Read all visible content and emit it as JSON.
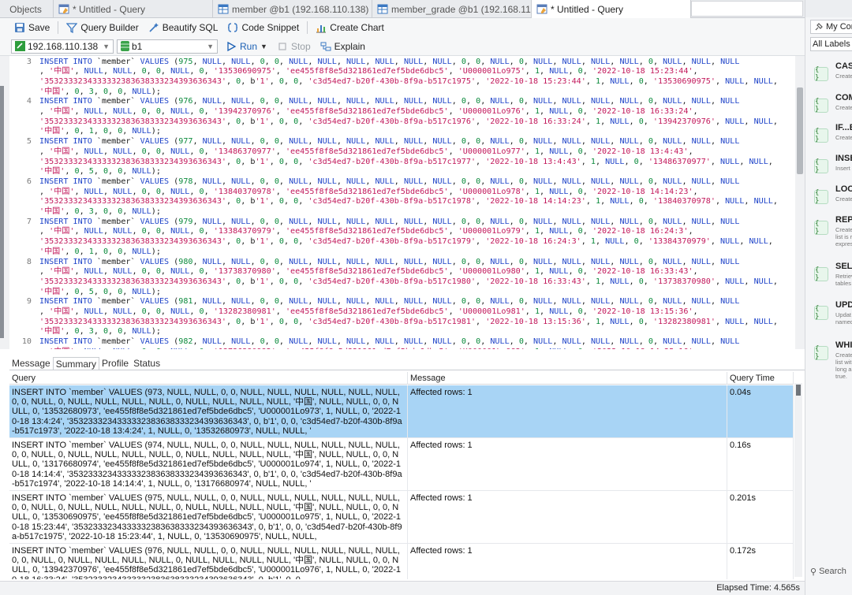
{
  "tabs": [
    {
      "label": "Objects",
      "icon": "none",
      "active": false
    },
    {
      "label": "* Untitled - Query",
      "icon": "query-icon",
      "active": false
    },
    {
      "label": "member @b1 (192.168.110.138) - T...",
      "icon": "table-icon",
      "active": false
    },
    {
      "label": "member_grade @b1 (192.168.110.1...",
      "icon": "table-icon",
      "active": false
    },
    {
      "label": "* Untitled - Query",
      "icon": "query-icon",
      "active": true
    }
  ],
  "toolbar": {
    "save": "Save",
    "query_builder": "Query Builder",
    "beautify_sql": "Beautify SQL",
    "code_snippet": "Code Snippet",
    "create_chart": "Create Chart"
  },
  "connection": {
    "server": "192.168.110.138",
    "database": "b1",
    "run": "Run",
    "stop": "Stop",
    "explain": "Explain"
  },
  "editor": {
    "lines": [
      {
        "n": "3",
        "t": [
          "INSERT INTO `member` VALUES (975, NULL, NULL, 0, 0, NULL, NULL, NULL, NULL, NULL, NULL, 0, 0, NULL, 0, NULL, NULL, NULL, NULL, 0, NULL, NULL, NULL",
          ", '中国', NULL, NULL, 0, 0, NULL, 0, '13530690975', 'ee455f8f8e5d321861ed7ef5bde6dbc5', 'U000001Lo975', 1, NULL, 0, '2022-10-18 15:23:44',",
          "'3532333234333332383638333234393636343', 0, b'1', 0, 0, 'c3d54ed7-b20f-430b-8f9a-b517c1975', '2022-10-18 15:23:44', 1, NULL, 0, '13530690975', NULL, NULL,",
          "'中国', 0, 3, 0, 0, NULL);"
        ]
      },
      {
        "n": "4",
        "t": [
          "INSERT INTO `member` VALUES (976, NULL, NULL, 0, 0, NULL, NULL, NULL, NULL, NULL, NULL, 0, 0, NULL, 0, NULL, NULL, NULL, NULL, 0, NULL, NULL, NULL",
          ", '中国', NULL, NULL, 0, 0, NULL, 0, '13942370976', 'ee455f8f8e5d321861ed7ef5bde6dbc5', 'U000001Lo976', 1, NULL, 0, '2022-10-18 16:33:24',",
          "'3532333234333332383638333234393636343', 0, b'1', 0, 0, 'c3d54ed7-b20f-430b-8f9a-b517c1976', '2022-10-18 16:33:24', 1, NULL, 0, '13942370976', NULL, NULL,",
          "'中国', 0, 1, 0, 0, NULL);"
        ]
      },
      {
        "n": "5",
        "t": [
          "INSERT INTO `member` VALUES (977, NULL, NULL, 0, 0, NULL, NULL, NULL, NULL, NULL, NULL, 0, 0, NULL, 0, NULL, NULL, NULL, NULL, 0, NULL, NULL, NULL",
          ", '中国', NULL, NULL, 0, 0, NULL, 0, '13486370977', 'ee455f8f8e5d321861ed7ef5bde6dbc5', 'U000001Lo977', 1, NULL, 0, '2022-10-18 13:4:43',",
          "'3532333234333332383638333234393636343', 0, b'1', 0, 0, 'c3d54ed7-b20f-430b-8f9a-b517c1977', '2022-10-18 13:4:43', 1, NULL, 0, '13486370977', NULL, NULL,",
          "'中国', 0, 5, 0, 0, NULL);"
        ]
      },
      {
        "n": "6",
        "t": [
          "INSERT INTO `member` VALUES (978, NULL, NULL, 0, 0, NULL, NULL, NULL, NULL, NULL, NULL, 0, 0, NULL, 0, NULL, NULL, NULL, NULL, 0, NULL, NULL, NULL",
          ", '中国', NULL, NULL, 0, 0, NULL, 0, '13840370978', 'ee455f8f8e5d321861ed7ef5bde6dbc5', 'U000001Lo978', 1, NULL, 0, '2022-10-18 14:14:23',",
          "'3532333234333332383638333234393636343', 0, b'1', 0, 0, 'c3d54ed7-b20f-430b-8f9a-b517c1978', '2022-10-18 14:14:23', 1, NULL, 0, '13840370978', NULL, NULL,",
          "'中国', 0, 3, 0, 0, NULL);"
        ]
      },
      {
        "n": "7",
        "t": [
          "INSERT INTO `member` VALUES (979, NULL, NULL, 0, 0, NULL, NULL, NULL, NULL, NULL, NULL, 0, 0, NULL, 0, NULL, NULL, NULL, NULL, 0, NULL, NULL, NULL",
          ", '中国', NULL, NULL, 0, 0, NULL, 0, '13384370979', 'ee455f8f8e5d321861ed7ef5bde6dbc5', 'U000001Lo979', 1, NULL, 0, '2022-10-18 16:24:3',",
          "'3532333234333332383638333234393636343', 0, b'1', 0, 0, 'c3d54ed7-b20f-430b-8f9a-b517c1979', '2022-10-18 16:24:3', 1, NULL, 0, '13384370979', NULL, NULL,",
          "'中国', 0, 1, 0, 0, NULL);"
        ]
      },
      {
        "n": "8",
        "t": [
          "INSERT INTO `member` VALUES (980, NULL, NULL, 0, 0, NULL, NULL, NULL, NULL, NULL, NULL, 0, 0, NULL, 0, NULL, NULL, NULL, NULL, 0, NULL, NULL, NULL",
          ", '中国', NULL, NULL, 0, 0, NULL, 0, '13738370980', 'ee455f8f8e5d321861ed7ef5bde6dbc5', 'U000001Lo980', 1, NULL, 0, '2022-10-18 16:33:43',",
          "'3532333234333332383638333234393636343', 0, b'1', 0, 0, 'c3d54ed7-b20f-430b-8f9a-b517c1980', '2022-10-18 16:33:43', 1, NULL, 0, '13738370980', NULL, NULL,",
          "'中国', 0, 5, 0, 0, NULL);"
        ]
      },
      {
        "n": "9",
        "t": [
          "INSERT INTO `member` VALUES (981, NULL, NULL, 0, 0, NULL, NULL, NULL, NULL, NULL, NULL, 0, 0, NULL, 0, NULL, NULL, NULL, NULL, 0, NULL, NULL, NULL",
          ", '中国', NULL, NULL, 0, 0, NULL, 0, '13282380981', 'ee455f8f8e5d321861ed7ef5bde6dbc5', 'U000001Lo981', 1, NULL, 0, '2022-10-18 13:15:36',",
          "'3532333234333332383638333234393636343', 0, b'1', 0, 0, 'c3d54ed7-b20f-430b-8f9a-b517c1981', '2022-10-18 13:15:36', 1, NULL, 0, '13282380981', NULL, NULL,",
          "'中国', 0, 3, 0, 0, NULL);"
        ]
      },
      {
        "n": "10",
        "t": [
          "INSERT INTO `member` VALUES (982, NULL, NULL, 0, 0, NULL, NULL, NULL, NULL, NULL, NULL, 0, 0, NULL, 0, NULL, NULL, NULL, NULL, 0, NULL, NULL, NULL",
          ", '中国', NULL, NULL, 0, 0, NULL, 0, '13736380982', 'ee455f8f8e5d321861ed7ef5bde6dbc5', 'U000001Lo982', 1, NULL, 0, '2022-10-18 14:25:16',"
        ]
      }
    ]
  },
  "result_tabs": [
    {
      "label": "Message",
      "active": false
    },
    {
      "label": "Summary",
      "active": true
    },
    {
      "label": "Profile",
      "active": false
    },
    {
      "label": "Status",
      "active": false
    }
  ],
  "grid": {
    "headers": {
      "query": "Query",
      "message": "Message",
      "time": "Query Time"
    },
    "rows": [
      {
        "query": "INSERT INTO `member` VALUES (973, NULL, NULL, 0, 0, NULL, NULL, NULL, NULL, NULL, NULL, 0, 0, NULL, 0, NULL, NULL, NULL, NULL, 0, NULL, NULL, NULL, NULL, '中国', NULL, NULL, 0, 0, NULL, 0, '13532680973', 'ee455f8f8e5d321861ed7ef5bde6dbc5', 'U000001Lo973', 1, NULL, 0, '2022-10-18 13:4:24', '3532333234333332383638333234393636343', 0, b'1', 0, 0, 'c3d54ed7-b20f-430b-8f9a-b517c1973', '2022-10-18 13:4:24', 1, NULL, 0, '13532680973', NULL, NULL, '",
        "message": "Affected rows: 1",
        "time": "0.04s",
        "selected": true
      },
      {
        "query": "INSERT INTO `member` VALUES (974, NULL, NULL, 0, 0, NULL, NULL, NULL, NULL, NULL, NULL, 0, 0, NULL, 0, NULL, NULL, NULL, NULL, 0, NULL, NULL, NULL, NULL, '中国', NULL, NULL, 0, 0, NULL, 0, '13176680974', 'ee455f8f8e5d321861ed7ef5bde6dbc5', 'U000001Lo974', 1, NULL, 0, '2022-10-18 14:14:4', '3532333234333332383638333234393636343', 0, b'1', 0, 0, 'c3d54ed7-b20f-430b-8f9a-b517c1974', '2022-10-18 14:14:4', 1, NULL, 0, '13176680974', NULL, NULL, '",
        "message": "Affected rows: 1",
        "time": "0.16s",
        "selected": false
      },
      {
        "query": "INSERT INTO `member` VALUES (975, NULL, NULL, 0, 0, NULL, NULL, NULL, NULL, NULL, NULL, 0, 0, NULL, 0, NULL, NULL, NULL, NULL, 0, NULL, NULL, NULL, NULL, '中国', NULL, NULL, 0, 0, NULL, 0, '13530690975', 'ee455f8f8e5d321861ed7ef5bde6dbc5', 'U000001Lo975', 1, NULL, 0, '2022-10-18 15:23:44', '3532333234333332383638333234393636343', 0, b'1', 0, 0, 'c3d54ed7-b20f-430b-8f9a-b517c1975', '2022-10-18 15:23:44', 1, NULL, 0, '13530690975', NULL, NULL,",
        "message": "Affected rows: 1",
        "time": "0.201s",
        "selected": false
      },
      {
        "query": "INSERT INTO `member` VALUES (976, NULL, NULL, 0, 0, NULL, NULL, NULL, NULL, NULL, NULL, 0, 0, NULL, 0, NULL, NULL, NULL, NULL, 0, NULL, NULL, NULL, NULL, '中国', NULL, NULL, 0, 0, NULL, 0, '13942370976', 'ee455f8f8e5d321861ed7ef5bde6dbc5', 'U000001Lo976', 1, NULL, 0, '2022-10-18 16:33:24', '3532333234333332383638333234393636343', 0, b'1', 0, 0,",
        "message": "Affected rows: 1",
        "time": "0.172s",
        "selected": false
      }
    ]
  },
  "status": {
    "elapsed": "Elapsed Time: 4.565s"
  },
  "right_panel": {
    "connection": "My Con",
    "labels": "All Labels",
    "snippets": [
      {
        "title": "CAS",
        "desc": [
          "Create"
        ]
      },
      {
        "title": "COM",
        "desc": [
          "Create"
        ]
      },
      {
        "title": "IF...E",
        "desc": [
          "Create"
        ]
      },
      {
        "title": "INSE",
        "desc": [
          "Insert"
        ]
      },
      {
        "title": "LOO",
        "desc": [
          "Create"
        ]
      },
      {
        "title": "REPI",
        "desc": [
          "Create",
          "list is r",
          "expres"
        ]
      },
      {
        "title": "SELE",
        "desc": [
          "Retriev",
          "tables"
        ]
      },
      {
        "title": "UPD",
        "desc": [
          "Updat",
          "named"
        ]
      },
      {
        "title": "WHI",
        "desc": [
          "Create",
          "list wit",
          "long a",
          "true."
        ]
      }
    ],
    "search": "Search"
  },
  "colors": {
    "selected_row": "#a8d4f5",
    "keyword": "#1f44c9",
    "string": "#c2185b",
    "number": "#0b8a3c"
  }
}
